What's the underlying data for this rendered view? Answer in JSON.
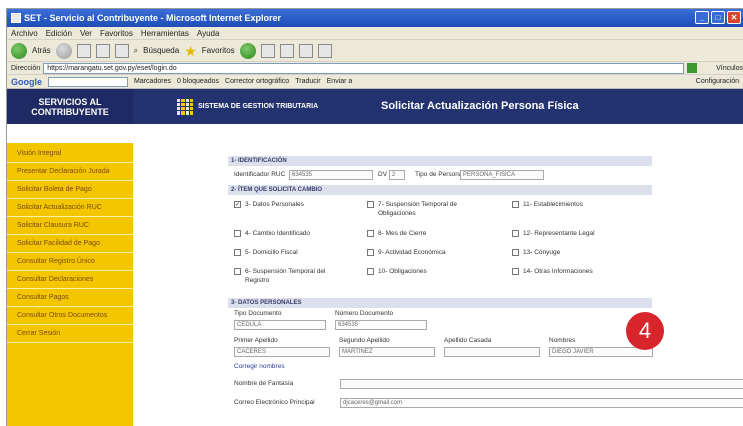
{
  "window": {
    "title": "SET - Servicio al Contribuyente - Microsoft Internet Explorer",
    "min": "_",
    "max": "□",
    "close": "✕"
  },
  "menu": [
    "Archivo",
    "Edición",
    "Ver",
    "Favoritos",
    "Herramientas",
    "Ayuda"
  ],
  "toolbar": {
    "back": "Atrás",
    "search": "Búsqueda",
    "favorites": "Favoritos"
  },
  "address": {
    "label": "Dirección",
    "url": "https://marangatu.set.gov.py/eset/login.do",
    "right": "Vínculos"
  },
  "google": {
    "logo": "Google",
    "items": [
      "Marcadores",
      "0 bloqueados",
      "Corrector ortográfico",
      "Traducir",
      "Enviar a"
    ],
    "settings": "Configuración"
  },
  "header": {
    "brand_line1": "SERVICIOS AL",
    "brand_line2": "CONTRIBUYENTE",
    "system": "SISTEMA DE GESTION TRIBUTARIA",
    "page_title": "Solicitar Actualización Persona Física"
  },
  "sidebar": [
    "Visión Integral",
    "Presentar Declaración Jurada",
    "Solicitar Boleta de Pago",
    "Solicitar Actualización RUC",
    "Solicitar Clausura RUC",
    "Solicitar Facilidad de Pago",
    "Consultar Registro Único",
    "Consultar Declaraciones",
    "Consultar Pagos",
    "Consultar Otros Documentos",
    "Cerrar Sesión"
  ],
  "form": {
    "sec1": "1- IDENTIFICACIÓN",
    "ruc_label": "Identificador RUC",
    "ruc_value": "634535",
    "dv_label": "DV",
    "dv_value": "2",
    "tipo_label": "Tipo de Persona",
    "tipo_value": "PERSONA_FISICA",
    "sec2": "2- ÍTEM QUE SOLICITA CAMBIO",
    "check_mark": "✓",
    "options": [
      "3- Datos Personales",
      "7- Suspensión Temporal de Obligaciones",
      "11- Establecimientos",
      "4- Cambio Identificado",
      "8- Mes de Cierre",
      "12- Representante Legal",
      "5- Domicilio Fiscal",
      "9- Actividad Económica",
      "13- Cónyuge",
      "6- Suspensión Temporal del Registro",
      "10- Obligaciones",
      "14- Otras Informaciones"
    ],
    "sec3": "3- DATOS PERSONALES",
    "tipo_doc_label": "Tipo Documento",
    "tipo_doc_value": "CEDULA",
    "num_doc_label": "Número Documento",
    "num_doc_value": "634535",
    "primer_label": "Primer Apellido",
    "primer_value": "CACERES",
    "segundo_label": "Segundo Apellido",
    "segundo_value": "MARTINEZ",
    "casada_label": "Apellido Casada",
    "casada_value": "",
    "nombres_label": "Nombres",
    "nombres_value": "DIEGO JAVIER",
    "corregir": "Corregir nombres",
    "fantasia_label": "Nombre de Fantasía",
    "fantasia_value": "",
    "correo_label": "Correo Electrónico Principal",
    "correo_value": "djcaceres@gmail.com"
  },
  "step_badge": "4",
  "colors": {
    "header_bg": "#233370",
    "sidebar_bg": "#f3c600",
    "badge": "#d8242b",
    "section_bg": "#dce0ec"
  }
}
